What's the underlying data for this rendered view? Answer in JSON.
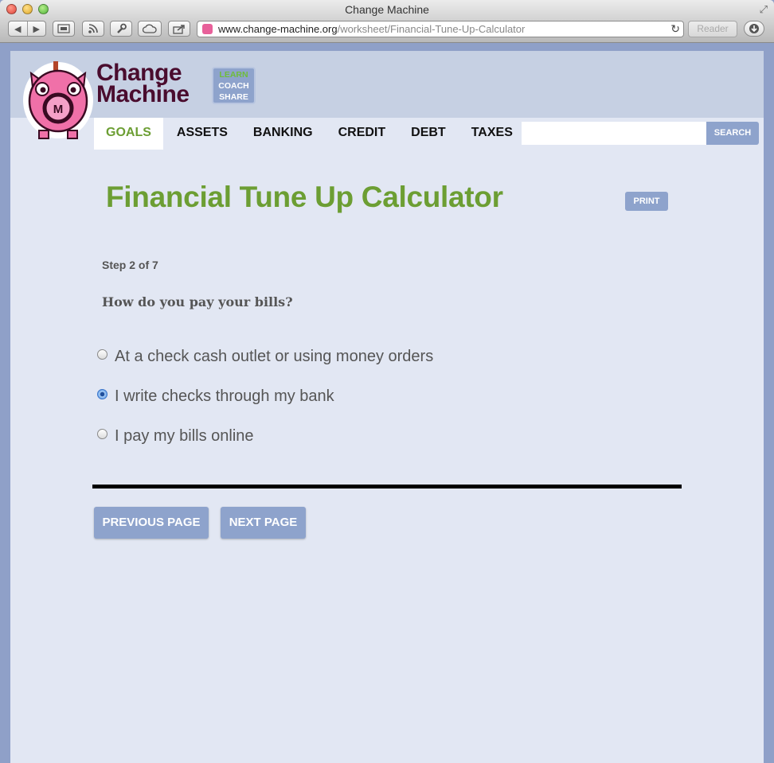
{
  "window": {
    "title": "Change Machine",
    "url_domain": "www.change-machine.org",
    "url_path": "/worksheet/Financial-Tune-Up-Calculator",
    "reader_label": "Reader"
  },
  "site": {
    "logo_line1": "Change",
    "logo_line2": "Machine",
    "tagline": [
      "LEARN",
      "COACH",
      "SHARE"
    ],
    "nav": [
      {
        "label": "GOALS",
        "active": true
      },
      {
        "label": "ASSETS",
        "active": false
      },
      {
        "label": "BANKING",
        "active": false
      },
      {
        "label": "CREDIT",
        "active": false
      },
      {
        "label": "DEBT",
        "active": false
      },
      {
        "label": "TAXES",
        "active": false
      }
    ],
    "search": {
      "value": "",
      "button_label": "SEARCH"
    }
  },
  "worksheet": {
    "title": "Financial Tune Up Calculator",
    "print_label": "PRINT",
    "step": "Step 2 of 7",
    "question": "How do you pay your bills?",
    "options": [
      {
        "label": "At a check cash outlet or using money orders",
        "checked": false
      },
      {
        "label": "I write checks through my bank",
        "checked": true
      },
      {
        "label": "I pay my bills online",
        "checked": false
      }
    ],
    "previous_label": "PREVIOUS PAGE",
    "next_label": "NEXT PAGE"
  },
  "colors": {
    "accent_green": "#6c9e33",
    "button_blue": "#8ea3cc",
    "header_bg": "#c6d0e3",
    "page_bg": "#e2e7f3",
    "logo_purple": "#4a0c2e"
  }
}
